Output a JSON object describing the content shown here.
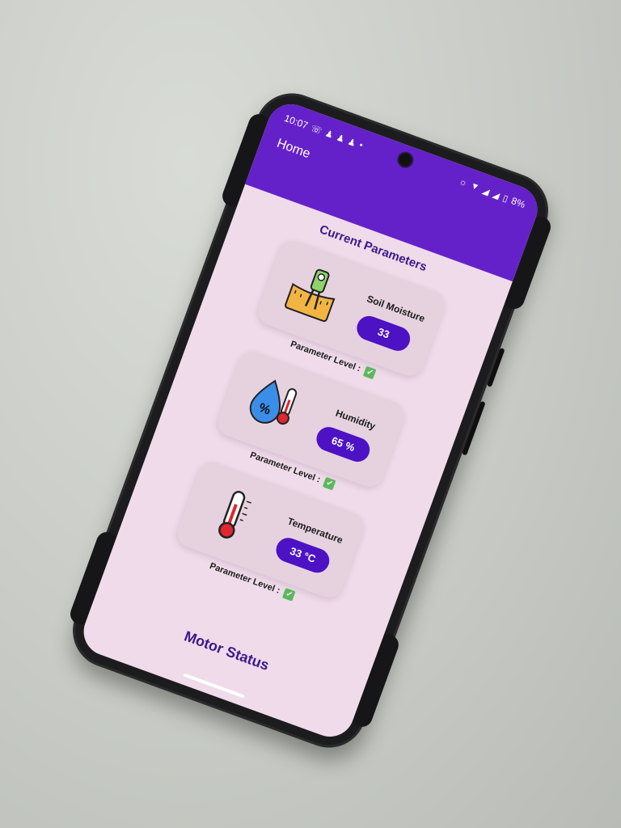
{
  "status_bar": {
    "time": "10:07",
    "battery": "8%",
    "left_icons": [
      "whatsapp-icon",
      "snapchat-icon",
      "snapchat-icon",
      "snapchat-icon",
      "dot-icon"
    ],
    "right_icons": [
      "vibrate-icon",
      "wifi-icon",
      "signal-icon",
      "signal-icon",
      "battery-icon"
    ]
  },
  "app_bar": {
    "title": "Home"
  },
  "section_title": "Current Parameters",
  "cards": [
    {
      "name": "Soil Moisture",
      "value": "33",
      "icon": "soil-moisture-sensor-icon",
      "level_label": "Parameter Level :"
    },
    {
      "name": "Humidity",
      "value": "65 %",
      "icon": "humidity-drop-icon",
      "level_label": "Parameter Level :"
    },
    {
      "name": "Temperature",
      "value": "33 °C",
      "icon": "thermometer-icon",
      "level_label": "Parameter Level :"
    }
  ],
  "level_icon": "check-icon",
  "bottom_section_title": "Motor Status",
  "colors": {
    "app_bar": "#6521c9",
    "value_pill": "#4c12c4",
    "card": "#e6d2df",
    "background": "#efdbe9",
    "title_text": "#3a1a8c",
    "check": "#5cb85c"
  }
}
